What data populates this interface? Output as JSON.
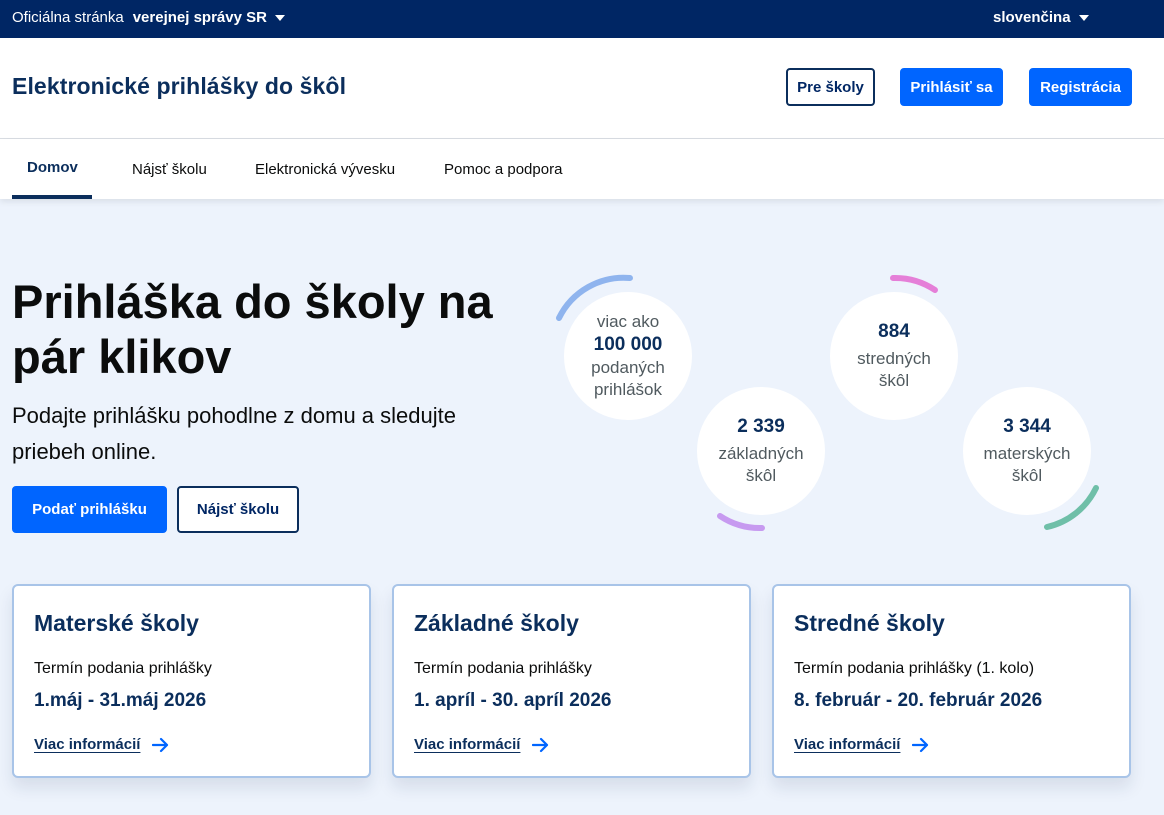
{
  "topbar": {
    "official_text": "Oficiálna stránka",
    "official_bold": "verejnej správy SR",
    "language": "slovenčina"
  },
  "header": {
    "site_title": "Elektronické prihlášky do škôl",
    "for_schools_label": "Pre školy",
    "login_label": "Prihlásiť sa",
    "register_label": "Registrácia"
  },
  "nav": {
    "items": [
      {
        "label": "Domov"
      },
      {
        "label": "Nájsť školu"
      },
      {
        "label": "Elektronická vývesku"
      },
      {
        "label": "Pomoc a podpora"
      }
    ]
  },
  "hero": {
    "title": "Prihláška do školy na pár klikov",
    "subtitle": "Podajte prihlášku pohodlne z domu a sledujte priebeh online.",
    "apply_label": "Podať prihlášku",
    "find_label": "Nájsť školu"
  },
  "stats": [
    {
      "prefix": "viac ako",
      "number": "100 000",
      "label": "podaných prihlášok"
    },
    {
      "prefix": "",
      "number": "2 339",
      "label": "základných škôl"
    },
    {
      "prefix": "",
      "number": "884",
      "label": "stredných škôl"
    },
    {
      "prefix": "",
      "number": "3 344",
      "label": "materských škôl"
    }
  ],
  "colors": {
    "primary": "#0065ff",
    "navy": "#002664",
    "arc_blue": "#8fb4ee",
    "arc_purple": "#c79af0",
    "arc_pink": "#e57fd8",
    "arc_teal": "#6fbfa8"
  },
  "cards": [
    {
      "title": "Materské školy",
      "term_label": "Termín podania prihlášky",
      "dates": "1.máj - 31.máj 2026",
      "link": "Viac informácií"
    },
    {
      "title": "Základné školy",
      "term_label": "Termín podania prihlášky",
      "dates": "1. apríl - 30. apríl 2026",
      "link": "Viac informácií"
    },
    {
      "title": "Stredné školy",
      "term_label": "Termín podania prihlášky (1. kolo)",
      "dates": "8. február - 20. február 2026",
      "link": "Viac informácií"
    }
  ]
}
